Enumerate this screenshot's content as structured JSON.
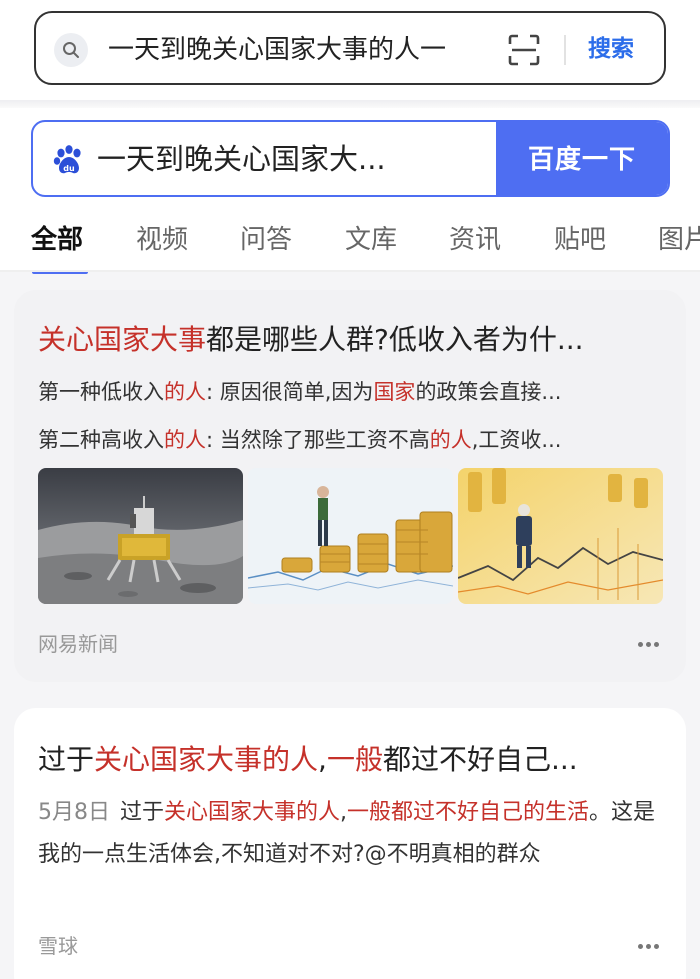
{
  "topbar": {
    "query": "一天到晚关心国家大事的人一",
    "search_label": "搜索"
  },
  "baidu": {
    "query": "一天到晚关心国家大...",
    "button": "百度一下",
    "tabs": [
      "全部",
      "视频",
      "问答",
      "文库",
      "资讯",
      "贴吧",
      "图片"
    ]
  },
  "results": [
    {
      "title_em": "关心国家大事",
      "title_rest": "都是哪些人群?低收入者为什...",
      "snippet1": {
        "a": "第一种低收入",
        "b": "的人",
        "c": ": 原因很简单,因为",
        "d": "国家",
        "e": "的政策会直接..."
      },
      "snippet2": {
        "a": "第二种高收入",
        "b": "的人",
        "c": ": 当然除了那些工资不高",
        "d": "的人",
        "e": ",工资收..."
      },
      "images": [
        "lunar-lander-photo",
        "coin-stacks-photo",
        "businessman-on-chart-photo"
      ],
      "source": "网易新闻"
    },
    {
      "title_a": "过于",
      "title_em": "关心国家大事的人",
      "title_b": ",",
      "title_em2": "一般",
      "title_rest": "都过不好自己...",
      "date": "5月8日",
      "body_a": "过于",
      "body_em": "关心国家大事的人",
      "body_b": ",",
      "body_em2": "一般都过不好自己的生活",
      "body_rest": "。这是我的一点生活体会,不知道对不对?@不明真相的群众",
      "source": "雪球"
    }
  ],
  "colors": {
    "accent": "#4e6ef2",
    "highlight": "#c5312a",
    "link": "#2c6dea"
  }
}
